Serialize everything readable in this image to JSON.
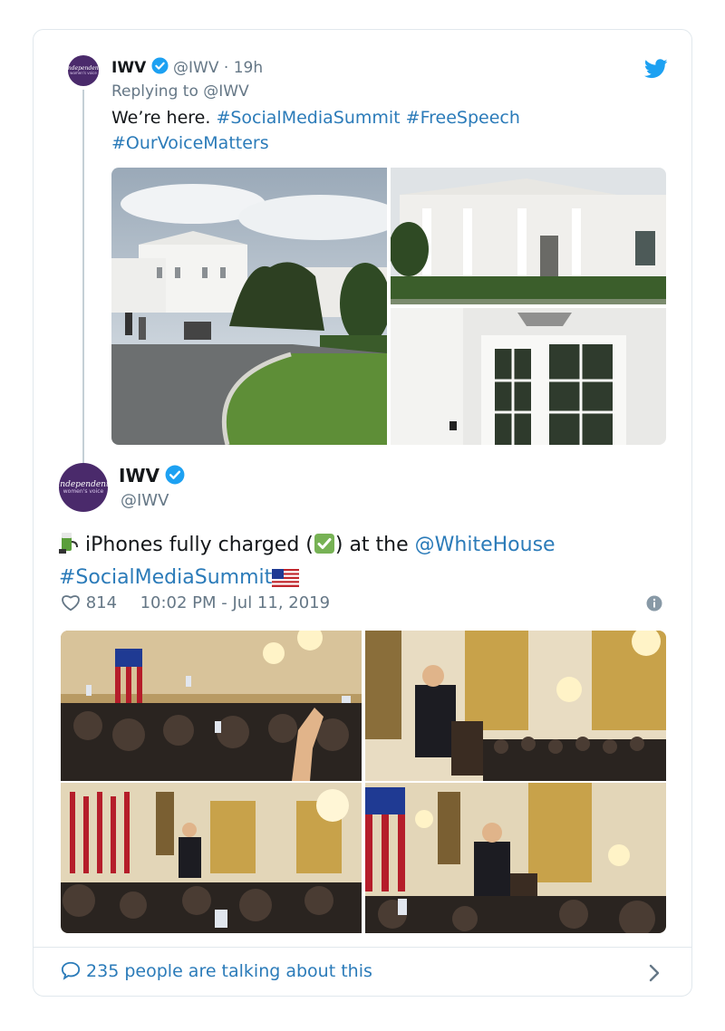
{
  "reply_tweet": {
    "display_name": "IWV",
    "handle": "@IWV",
    "separator": "·",
    "age": "19h",
    "replying_to_label": "Replying to",
    "replying_to_handle": "@IWV",
    "text_plain": "We’re here.",
    "hashtags": [
      "#SocialMediaSummit",
      "#FreeSpeech",
      "#OurVoiceMatters"
    ],
    "avatar_text_line1": "independent",
    "avatar_text_line2": "women's voice"
  },
  "main_tweet": {
    "display_name": "IWV",
    "handle": "@IWV",
    "text_part1": "iPhones fully charged (",
    "text_part2": ") at the",
    "mention": "@WhiteHouse",
    "hashtag": "#SocialMediaSummit",
    "like_count": "814",
    "timestamp": "10:02 PM - Jul 11, 2019",
    "avatar_text_line1": "independent",
    "avatar_text_line2": "women's voice"
  },
  "footer": {
    "talking_text": "235 people are talking about this"
  },
  "icons": {
    "brand": "twitter-bird-icon",
    "verified": "verified-badge-icon",
    "like": "heart-icon",
    "info": "info-icon",
    "reply": "speech-bubble-icon",
    "next": "chevron-right-icon"
  },
  "colors": {
    "link": "#2b7bb9",
    "verified": "#1da1f2",
    "twitter": "#1da1f2",
    "muted": "#657786",
    "border": "#e1e8ed",
    "avatar": "#4a2a6b"
  }
}
